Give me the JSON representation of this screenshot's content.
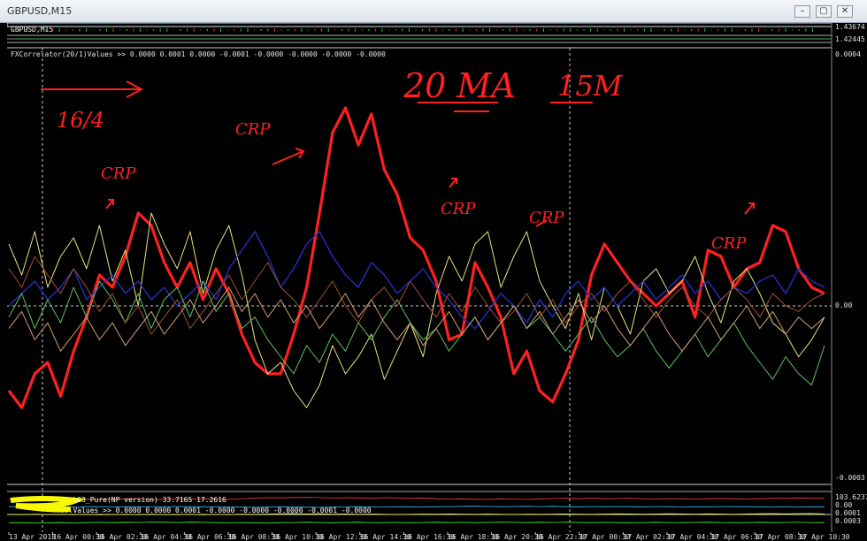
{
  "window": {
    "title": "GBPUSD,M15",
    "minimize_label": "–",
    "restore_label": "▢",
    "close_label": "✕"
  },
  "main_panel": {
    "symbol_label": "GBPUSD,M15",
    "price_top": "1.43674",
    "price_second": "1.42445"
  },
  "indicator_panel": {
    "label": "FXCorrelator(20/1)Values >> 0.0000 0.0001 0.0000 -0.0001 -0.0000 -0.0000 -0.0000 -0.0000",
    "scale_top": "0.0004",
    "scale_zero": "0.00",
    "scale_bottom": "-0.0003"
  },
  "bottom_panels": {
    "rsi_label": "...LC3_Pure(NP version) 33.7165 17.2616",
    "values_label": "...Values >> 0.0000 0.0000 0.0001 -0.0000 -0.0000 -0.0000 -0.0001 -0.0000",
    "scale_a": "103.6237",
    "scale_b": "0.00",
    "scale_c": "0.0001",
    "scale_d": "0.0003"
  },
  "annotations": {
    "ma_note": "20 MA",
    "tf_note": "15M",
    "date_note": "16/4",
    "crp_labels": [
      "CRP",
      "CRP",
      "CRP",
      "CRP",
      "CRP"
    ]
  },
  "chart_data": {
    "type": "line",
    "ylim": [
      -0.0003,
      0.0004
    ],
    "x_ticks": [
      "13 Apr 2018",
      "16 Apr 00:30",
      "16 Apr 02:30",
      "16 Apr 04:30",
      "16 Apr 06:30",
      "16 Apr 08:30",
      "16 Apr 10:30",
      "16 Apr 12:30",
      "16 Apr 14:30",
      "16 Apr 16:30",
      "16 Apr 18:30",
      "16 Apr 20:30",
      "16 Apr 22:30",
      "17 Apr 00:30",
      "17 Apr 02:30",
      "17 Apr 04:30",
      "17 Apr 06:30",
      "17 Apr 08:30",
      "17 Apr 10:30"
    ],
    "series": [
      {
        "color": "#ff2020",
        "values": [
          -0.00015,
          -0.00018,
          -0.00012,
          -0.0001,
          -0.00016,
          -8e-05,
          -2e-05,
          5e-05,
          3e-05,
          8e-05,
          0.00015,
          0.00013,
          7e-05,
          3e-05,
          7e-05,
          1e-05,
          6e-05,
          2e-05,
          -5e-05,
          -0.0001,
          -0.00012,
          -0.00012,
          -5e-05,
          3e-05,
          0.00015,
          0.00028,
          0.00032,
          0.00026,
          0.00031,
          0.00022,
          0.00018,
          0.00011,
          9e-05,
          4e-05,
          -6e-05,
          -5e-05,
          7e-05,
          3e-05,
          -2e-05,
          -0.00012,
          -8e-05,
          -0.00015,
          -0.00017,
          -0.00012,
          -6e-05,
          5e-05,
          0.0001,
          7e-05,
          4e-05,
          2e-05,
          0.0,
          2e-05,
          4e-05,
          -2e-05,
          9e-05,
          8e-05,
          3e-05,
          6e-05,
          7e-05,
          0.00013,
          0.00012,
          6e-05,
          3e-05,
          2e-05
        ],
        "width": 3.2
      },
      {
        "color": "#e8e080",
        "values": [
          0.0001,
          5e-05,
          0.00012,
          3e-05,
          8e-05,
          0.00011,
          6e-05,
          0.00013,
          4e-05,
          9e-05,
          0.0,
          0.00015,
          0.0001,
          6e-05,
          0.00012,
          2e-05,
          9e-05,
          0.00013,
          5e-05,
          -6e-05,
          -0.00012,
          -0.0001,
          -0.00015,
          -0.00018,
          -0.00014,
          -7e-05,
          -0.00012,
          -9e-05,
          -5e-05,
          -0.00013,
          -8e-05,
          -3e-05,
          -9e-05,
          2e-05,
          8e-05,
          4e-05,
          0.0001,
          0.00012,
          3e-05,
          8e-05,
          0.00012,
          4e-05,
          0.0,
          -4e-05,
          2e-05,
          -6e-05,
          3e-05,
          0.0,
          -5e-05,
          4e-05,
          6e-05,
          2e-05,
          4e-05,
          8e-05,
          2e-05,
          -3e-05,
          4e-05,
          6e-05,
          2e-05,
          -3e-05,
          -5e-05,
          -9e-05,
          -6e-05,
          -2e-05
        ],
        "width": 1
      },
      {
        "color": "#2030c0",
        "values": [
          0.0,
          2e-05,
          4e-05,
          1e-05,
          3e-05,
          6e-05,
          1e-05,
          3e-05,
          5e-05,
          2e-05,
          4e-05,
          1e-05,
          3e-05,
          0.0,
          2e-05,
          4e-05,
          1e-05,
          6e-05,
          9e-05,
          0.00012,
          8e-05,
          3e-05,
          6e-05,
          0.0001,
          0.00012,
          8e-05,
          5e-05,
          3e-05,
          7e-05,
          5e-05,
          2e-05,
          4e-05,
          6e-05,
          3e-05,
          1e-05,
          -2e-05,
          -4e-05,
          -1e-05,
          2e-05,
          0.0,
          -3e-05,
          1e-05,
          -2e-05,
          2e-05,
          4e-05,
          1e-05,
          3e-05,
          0.0,
          2e-05,
          4e-05,
          1e-05,
          3e-05,
          5e-05,
          2e-05,
          4e-05,
          1e-05,
          3e-05,
          2e-05,
          4e-05,
          5e-05,
          2e-05,
          6e-05,
          4e-05,
          3e-05
        ],
        "width": 1.4
      },
      {
        "color": "#60c060",
        "values": [
          -2e-05,
          2e-05,
          -4e-05,
          1e-05,
          -3e-05,
          3e-05,
          -2e-05,
          4e-05,
          1e-05,
          -3e-05,
          2e-05,
          -4e-05,
          1e-05,
          3e-05,
          -2e-05,
          4e-05,
          -1e-05,
          2e-05,
          -4e-05,
          -2e-05,
          -6e-05,
          -9e-05,
          -0.00012,
          -7e-05,
          -0.0001,
          -5e-05,
          -8e-05,
          -3e-05,
          -6e-05,
          -2e-05,
          1e-05,
          -3e-05,
          -6e-05,
          -4e-05,
          -8e-05,
          -5e-05,
          -2e-05,
          -6e-05,
          -3e-05,
          0.0,
          -4e-05,
          -2e-05,
          -5e-05,
          -8e-05,
          -5e-05,
          -2e-05,
          -6e-05,
          -9e-05,
          -7e-05,
          -4e-05,
          -8e-05,
          -0.00011,
          -8e-05,
          -5e-05,
          -9e-05,
          -6e-05,
          -3e-05,
          -7e-05,
          -0.0001,
          -0.00013,
          -9e-05,
          -0.00012,
          -0.00014,
          -7e-05
        ],
        "width": 1
      },
      {
        "color": "#a05030",
        "values": [
          6e-05,
          3e-05,
          8e-05,
          5e-05,
          2e-05,
          6e-05,
          3e-05,
          -1e-05,
          2e-05,
          -3e-05,
          0.0,
          -5e-05,
          -2e-05,
          1e-05,
          -4e-05,
          -1e-05,
          2e-05,
          5e-05,
          1e-05,
          4e-05,
          7e-05,
          3e-05,
          1e-05,
          -2e-05,
          1e-05,
          4e-05,
          0.0,
          -3e-05,
          1e-05,
          3e-05,
          0.0,
          4e-05,
          1e-05,
          -2e-05,
          2e-05,
          -1e-05,
          3e-05,
          0.0,
          -3e-05,
          -1e-05,
          2e-05,
          -2e-05,
          1e-05,
          -3e-05,
          0.0,
          2e-05,
          -1e-05,
          2e-05,
          4e-05,
          1e-05,
          -2e-05,
          1e-05,
          3e-05,
          0.0,
          -2e-05,
          1e-05,
          3e-05,
          1e-05,
          -2e-05,
          2e-05,
          0.0,
          -1e-05,
          1e-05,
          2e-05
        ],
        "width": 1
      },
      {
        "color": "#d0a070",
        "values": [
          -4e-05,
          -1e-05,
          -6e-05,
          -3e-05,
          -8e-05,
          -5e-05,
          -2e-05,
          -6e-05,
          -3e-05,
          -7e-05,
          -4e-05,
          -1e-05,
          -5e-05,
          -2e-05,
          1e-05,
          -3e-05,
          0.0,
          3e-05,
          -1e-05,
          2e-05,
          -2e-05,
          1e-05,
          -3e-05,
          0.0,
          -4e-05,
          -1e-05,
          2e-05,
          -2e-05,
          1e-05,
          -3e-05,
          -6e-05,
          -3e-05,
          -7e-05,
          -4e-05,
          -1e-05,
          -5e-05,
          -2e-05,
          -6e-05,
          -3e-05,
          0.0,
          -4e-05,
          -1e-05,
          -5e-05,
          -2e-05,
          1e-05,
          -3e-05,
          0.0,
          -4e-05,
          -7e-05,
          -4e-05,
          -1e-05,
          -5e-05,
          -8e-05,
          -5e-05,
          -2e-05,
          -6e-05,
          -3e-05,
          0.0,
          -4e-05,
          -1e-05,
          -5e-05,
          -2e-05,
          -4e-05,
          -2e-05
        ],
        "width": 1
      }
    ]
  }
}
